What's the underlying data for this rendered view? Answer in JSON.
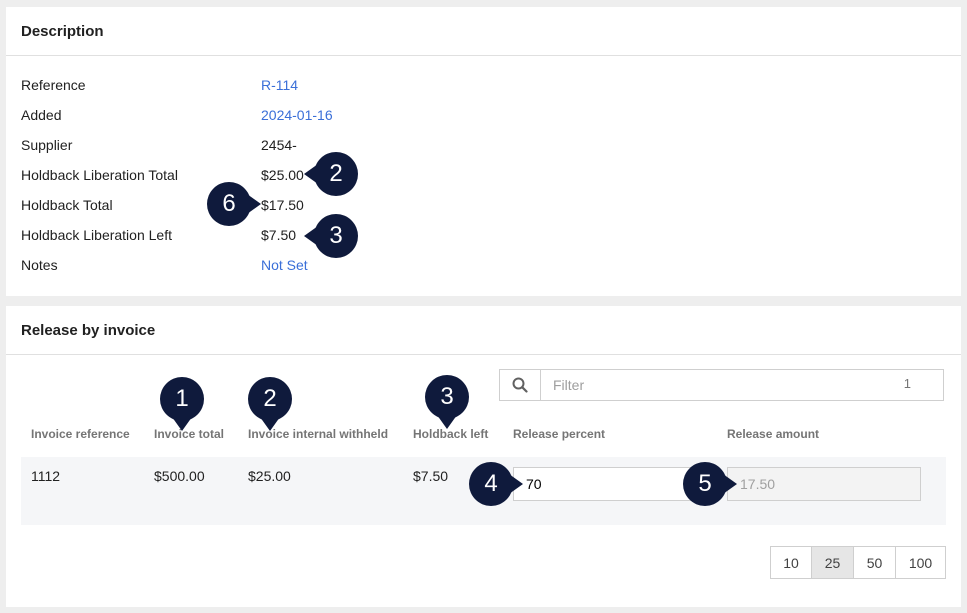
{
  "description": {
    "title": "Description",
    "rows": [
      {
        "label": "Reference",
        "value": "R-114",
        "link": true
      },
      {
        "label": "Added",
        "value": "2024-01-16",
        "link": true
      },
      {
        "label": "Supplier",
        "value": "2454-",
        "link": false
      },
      {
        "label": "Holdback Liberation Total",
        "value": "$25.00",
        "link": false
      },
      {
        "label": "Holdback Total",
        "value": "$17.50",
        "link": false
      },
      {
        "label": "Holdback Liberation Left",
        "value": "$7.50",
        "link": false
      },
      {
        "label": "Notes",
        "value": "Not Set",
        "link": true
      }
    ]
  },
  "release": {
    "title": "Release by invoice",
    "filter": {
      "placeholder": "Filter",
      "count": "1",
      "icon": "search-icon"
    },
    "columns": [
      "Invoice reference",
      "Invoice total",
      "Invoice internal withheld",
      "Holdback left",
      "Release percent",
      "Release amount"
    ],
    "rows": [
      {
        "reference": "1112",
        "total": "$500.00",
        "withheld": "$25.00",
        "left": "$7.50",
        "percent": "70",
        "amount": "17.50"
      }
    ],
    "page_sizes": [
      "10",
      "25",
      "50",
      "100"
    ],
    "active_page_size": "25"
  },
  "markers": [
    "1",
    "2",
    "3",
    "4",
    "5",
    "6",
    "2",
    "3"
  ],
  "colors": {
    "link": "#3a6fd8",
    "marker": "#0f1a3c"
  }
}
